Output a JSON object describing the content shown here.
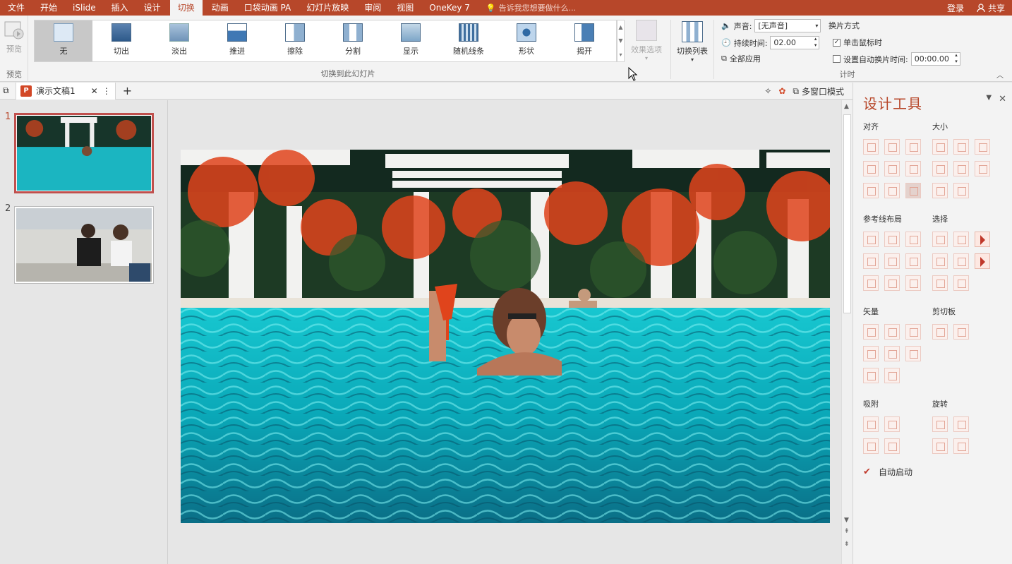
{
  "menu": {
    "tabs": [
      "文件",
      "开始",
      "iSlide",
      "插入",
      "设计",
      "切换",
      "动画",
      "口袋动画 PA",
      "幻灯片放映",
      "审阅",
      "视图",
      "OneKey 7"
    ],
    "active_tab": "切换",
    "tell_me": "告诉我您想要做什么...",
    "login": "登录",
    "share": "共享"
  },
  "ribbon": {
    "preview_label": "预览",
    "preview_group": "预览",
    "transitions": [
      "无",
      "切出",
      "淡出",
      "推进",
      "擦除",
      "分割",
      "显示",
      "随机线条",
      "形状",
      "揭开"
    ],
    "selected_transition": "无",
    "gallery_group": "切换到此幻灯片",
    "effect_options": "效果选项",
    "switch_list": "切换列表",
    "timing": {
      "sound_label": "声音:",
      "sound_value": "[无声音]",
      "duration_label": "持续时间:",
      "duration_value": "02.00",
      "apply_all": "全部应用",
      "advance_title": "换片方式",
      "on_click": "单击鼠标时",
      "after_time": "设置自动换片时间:",
      "after_value": "00:00.00",
      "group_label": "计时"
    }
  },
  "docbar": {
    "doc_title": "演示文稿1",
    "multi_window": "多窗口模式"
  },
  "slides": [
    {
      "number": "1",
      "desc": "pool"
    },
    {
      "number": "2",
      "desc": "beach"
    }
  ],
  "tools": {
    "title": "设计工具",
    "sections": {
      "align": "对齐",
      "size": "大小",
      "guide": "参考线布局",
      "select": "选择",
      "vector": "矢量",
      "clipboard": "剪切板",
      "snap": "吸附",
      "rotate": "旋转"
    },
    "auto_start": "自动启动"
  },
  "colors": {
    "accent": "#b7472a",
    "pool": "#1bb5c1",
    "flowers": "#e0441c"
  }
}
